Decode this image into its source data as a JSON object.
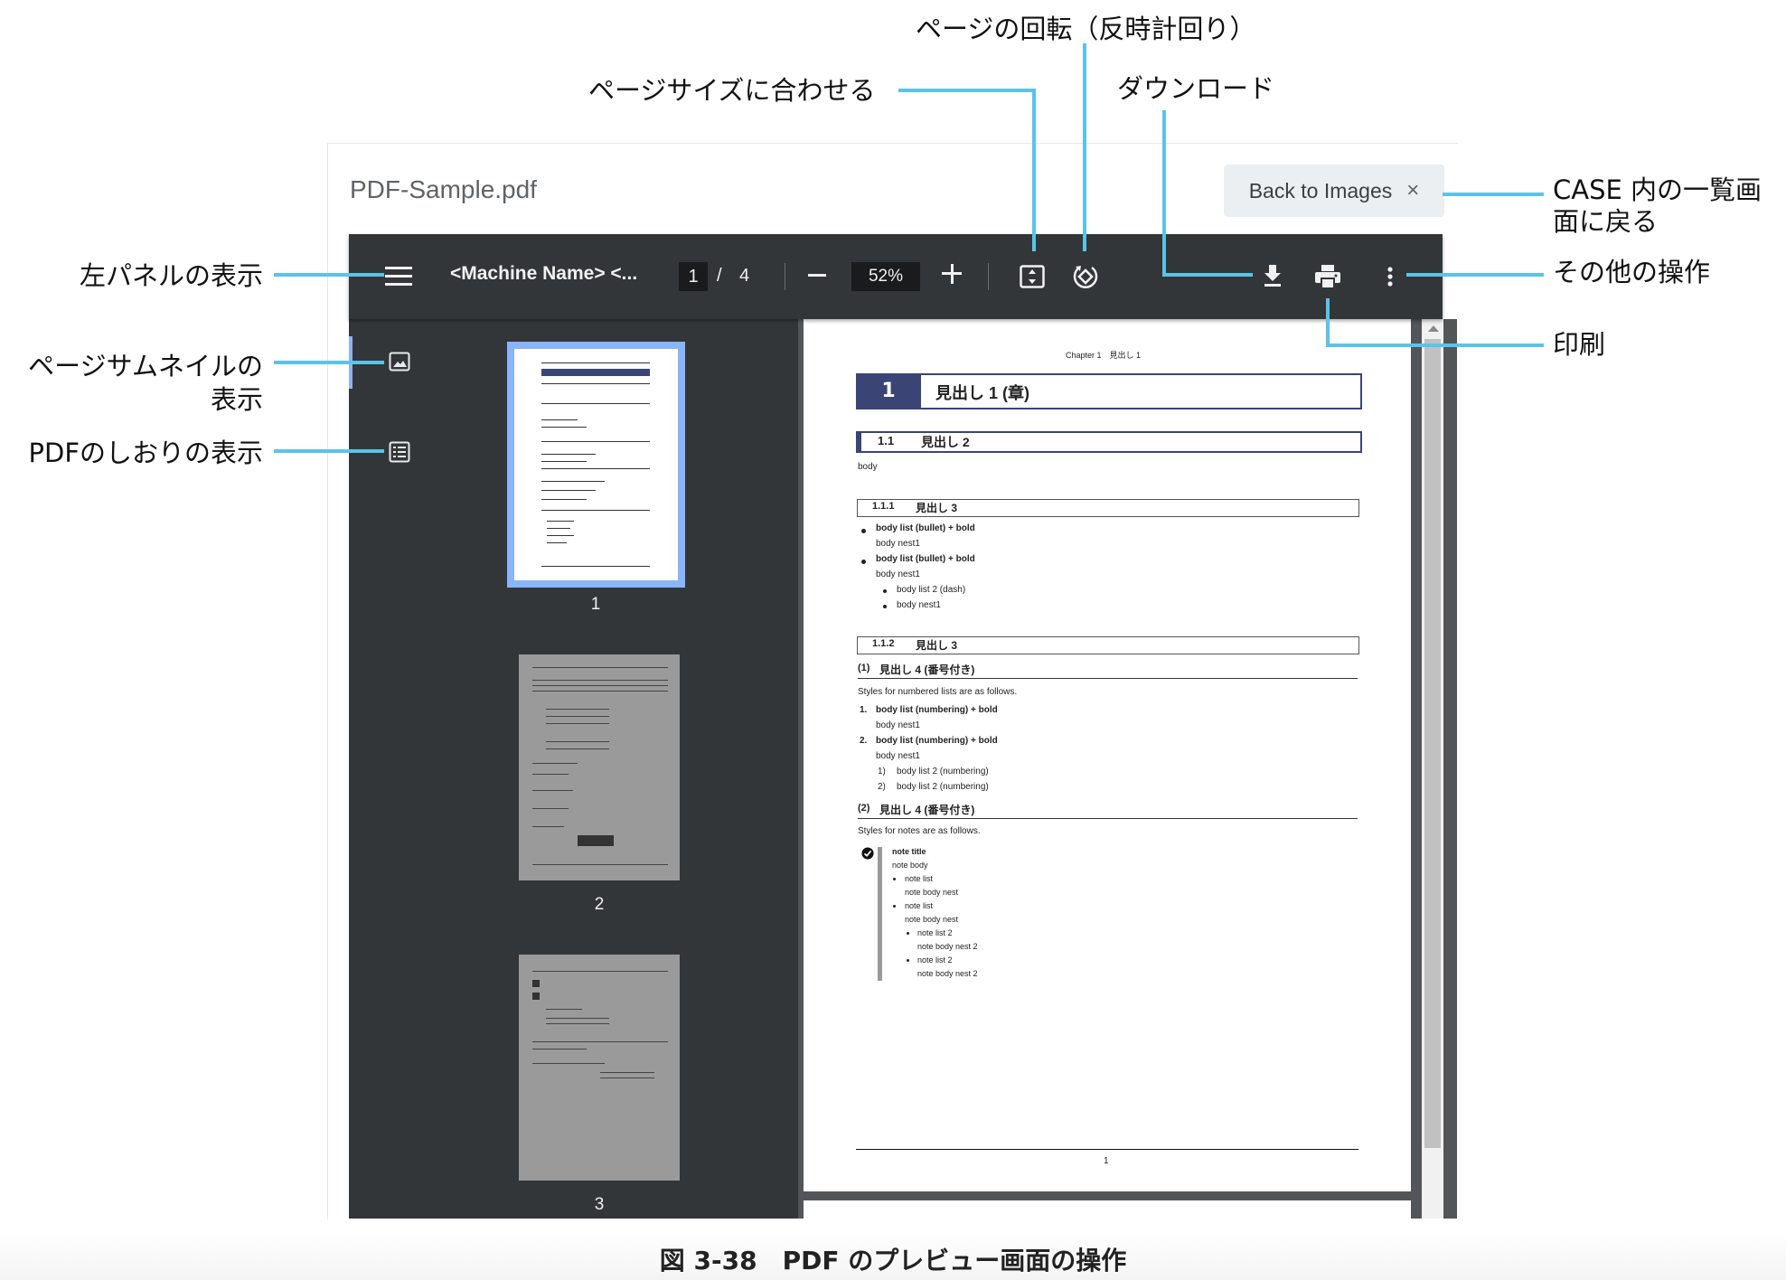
{
  "callouts": {
    "rotate": "ページの回転（反時計回り）",
    "fit": "ページサイズに合わせる",
    "download": "ダウンロード",
    "back_line1": "CASE 内の一覧画",
    "back_line2": "面に戻る",
    "more": "その他の操作",
    "print": "印刷",
    "left_panel": "左パネルの表示",
    "thumbnail_line1": "ページサムネイルの",
    "thumbnail_line2": "表示",
    "bookmarks": "PDFのしおりの表示"
  },
  "viewer": {
    "filename": "PDF-Sample.pdf",
    "back_label": "Back to Images",
    "back_close": "×",
    "doc_title": "<Machine Name> <...",
    "page_current": "1",
    "page_sep": "/",
    "page_total": "4",
    "zoom": "52%"
  },
  "thumbnails": [
    {
      "label": "1",
      "selected": true
    },
    {
      "label": "2",
      "selected": false
    },
    {
      "label": "3",
      "selected": false
    }
  ],
  "page": {
    "header": "Chapter 1　見出し 1",
    "h1_num": "1",
    "h1": "見出し 1 (章)",
    "h2_num": "1.1",
    "h2": "見出し 2",
    "body": "body",
    "h3a_num": "1.1.1",
    "h3a": "見出し 3",
    "bullets": [
      "body list (bullet) + bold",
      "body nest1",
      "body list (bullet) + bold",
      "body nest1",
      "body list 2 (dash)",
      "body nest1"
    ],
    "h3b_num": "1.1.2",
    "h3b": "見出し 3",
    "h4a_num": "(1)",
    "h4a": "見出し 4 (番号付き)",
    "numbered_intro": "Styles for numbered lists are as follows.",
    "numbered": [
      {
        "num": "1.",
        "text": "body list (numbering) + bold"
      },
      {
        "num": "",
        "text": "body nest1"
      },
      {
        "num": "2.",
        "text": "body list (numbering) + bold"
      },
      {
        "num": "",
        "text": "body nest1"
      },
      {
        "num": "1)",
        "text": "body list 2 (numbering)"
      },
      {
        "num": "2)",
        "text": "body list 2 (numbering)"
      }
    ],
    "h4b_num": "(2)",
    "h4b": "見出し 4 (番号付き)",
    "notes_intro": "Styles for notes are as follows.",
    "note_lines": [
      "note title",
      "note body",
      "note list",
      "note body nest",
      "note list",
      "note body nest",
      "note list 2",
      "note body nest 2",
      "note list 2",
      "note body nest 2"
    ],
    "footer_page": "1"
  },
  "caption": "図 3-38　PDF のプレビュー画面の操作",
  "colors": {
    "callout_line": "#5bc3ea",
    "toolbar": "#323639",
    "accent": "#8ab4f8",
    "heading": "#3a4576"
  }
}
